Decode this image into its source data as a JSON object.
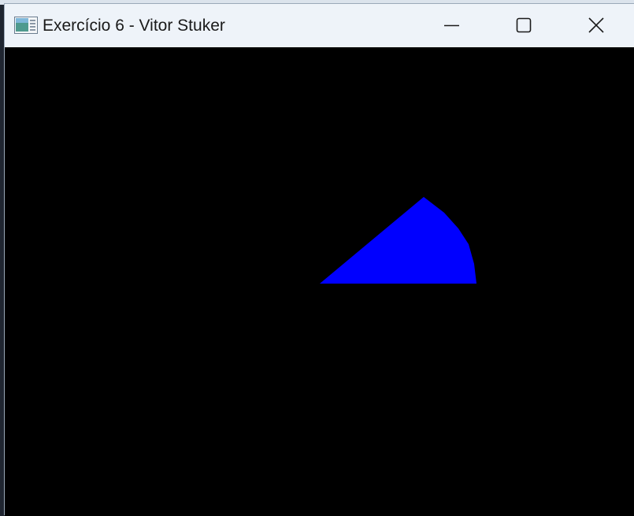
{
  "window": {
    "title": "Exercício 6 - Vitor Stuker",
    "app_icon": "app-window-icon",
    "controls": [
      "minimize-icon",
      "maximize-icon",
      "close-icon"
    ]
  },
  "canvas": {
    "background": "#000000",
    "shape": {
      "type": "circular-sector",
      "fill": "#0000ff"
    }
  }
}
